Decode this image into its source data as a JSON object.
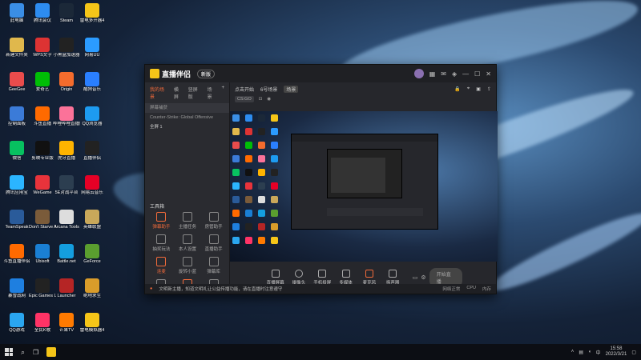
{
  "desktop": {
    "icons": [
      {
        "label": "此电脑",
        "color": "#3a8ee6"
      },
      {
        "label": "腾讯会议",
        "color": "#2d8cf0"
      },
      {
        "label": "Steam",
        "color": "#1b2838"
      },
      {
        "label": "雷电多开器4",
        "color": "#f5c518"
      },
      {
        "label": "新建文件夹",
        "color": "#e0b84c"
      },
      {
        "label": "WPS文字",
        "color": "#d33"
      },
      {
        "label": "小黑盒加速器",
        "color": "#222"
      },
      {
        "label": "网易UU",
        "color": "#2b9bff"
      },
      {
        "label": "GeeGee",
        "color": "#e94c4c"
      },
      {
        "label": "爱奇艺",
        "color": "#00be06"
      },
      {
        "label": "Origin",
        "color": "#f56c2d"
      },
      {
        "label": "酷狗音乐",
        "color": "#2a7fff"
      },
      {
        "label": "控制面板",
        "color": "#3b7bd8"
      },
      {
        "label": "斗鱼直播",
        "color": "#ff6a00"
      },
      {
        "label": "哔哩哔哩直播姬",
        "color": "#fb7299"
      },
      {
        "label": "QQ浏览器",
        "color": "#1d9bf0"
      },
      {
        "label": "微信",
        "color": "#07c160"
      },
      {
        "label": "剪映专业版",
        "color": "#111"
      },
      {
        "label": "虎牙直播",
        "color": "#ffb400"
      },
      {
        "label": "直播伴侣",
        "color": "#222"
      },
      {
        "label": "腾讯应用宝",
        "color": "#2bb5ff"
      },
      {
        "label": "WeGame",
        "color": "#e8333b"
      },
      {
        "label": "5E对战平台",
        "color": "#2c3e50"
      },
      {
        "label": "网易云音乐",
        "color": "#e60026"
      },
      {
        "label": "TeamSpeak",
        "color": "#2a5b9a"
      },
      {
        "label": "Don't Starve Together",
        "color": "#7a5b3a"
      },
      {
        "label": "Arcana Tools",
        "color": "#ddd"
      },
      {
        "label": "英雄联盟",
        "color": "#c9a85a"
      },
      {
        "label": "斗鱼直播伴侣",
        "color": "#ff6a00"
      },
      {
        "label": "Ubisoft",
        "color": "#1a7fd4"
      },
      {
        "label": "Battle.net",
        "color": "#149edf"
      },
      {
        "label": "GeForce",
        "color": "#5a9e2f"
      },
      {
        "label": "暴雪战网",
        "color": "#1e7fe0"
      },
      {
        "label": "Epic Games Launcher",
        "color": "#222"
      },
      {
        "label": "Launcher",
        "color": "#b52525"
      },
      {
        "label": "绝地求生",
        "color": "#d99c2a"
      },
      {
        "label": "QQ游戏",
        "color": "#2aa6f0"
      },
      {
        "label": "全民K歌",
        "color": "#ff3366"
      },
      {
        "label": "芒果TV",
        "color": "#ff7a00"
      },
      {
        "label": "雷电模拟器4",
        "color": "#f5c518"
      }
    ]
  },
  "app": {
    "name": "直播伴侣",
    "version": "新版"
  },
  "left_tabs": [
    "我的场景",
    "横屏",
    "竖屏版",
    "场景"
  ],
  "sources": [
    "屏幕捕获",
    "Counter-Strike: Global Offensive",
    "全屏 1"
  ],
  "tools_title": "工具箱",
  "tools": [
    "弹幕助手",
    "主播任务",
    "房管助手",
    "抽奖玩法",
    "本人设置",
    "直播助手",
    "连麦",
    "旋转小蓝",
    "弹幕库",
    "",
    "",
    ""
  ],
  "scenes": {
    "items": [
      "点击开始",
      "6号场景",
      "场景"
    ],
    "game_chip": "CS:GO"
  },
  "controls": [
    "直播屏幕",
    "摄像头",
    "手机投屏",
    "多媒体",
    "麦克风",
    "扬声器"
  ],
  "go_live": "开始直播",
  "status": {
    "notice": "文明新主播，知道文明礼让公益传播功能，请在直播时注意遵守",
    "right": [
      "网络正常",
      "CPU",
      "内存"
    ]
  },
  "taskbar": {
    "time": "15:58",
    "date": "2022/3/21"
  }
}
